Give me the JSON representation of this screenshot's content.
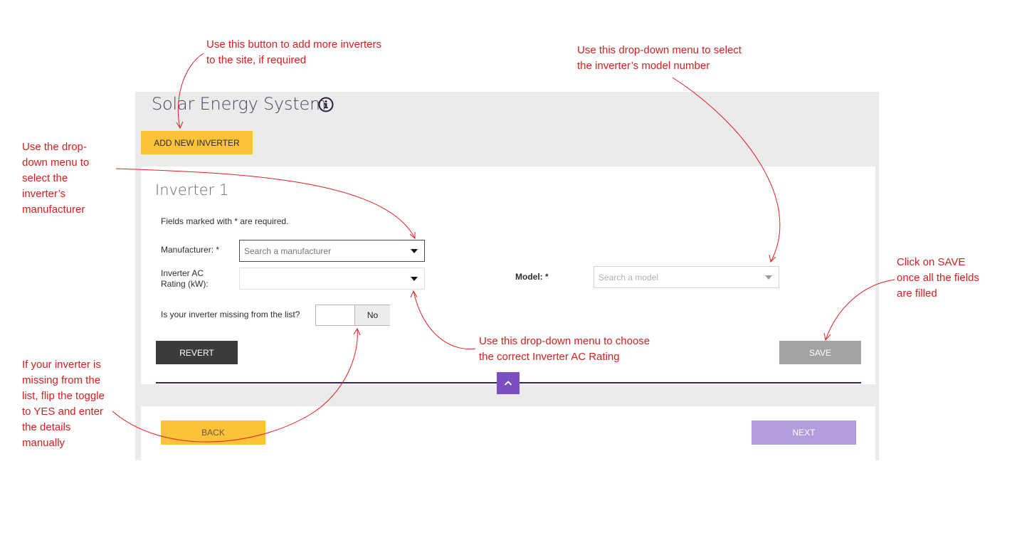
{
  "app": {
    "title": "Solar Energy System",
    "add_button": "ADD NEW INVERTER"
  },
  "inverter": {
    "heading": "Inverter 1",
    "required_note": "Fields marked with  *  are required.",
    "manufacturer_label": "Manufacturer: *",
    "manufacturer_placeholder": "Search a manufacturer",
    "rating_label_1": "Inverter AC",
    "rating_label_2": "Rating (kW):",
    "rating_value": "",
    "model_label": "Model: *",
    "model_placeholder": "Search a model",
    "missing_label": "Is your inverter missing from the list?",
    "missing_value": "No",
    "revert_button": "REVERT",
    "save_button": "SAVE"
  },
  "footer": {
    "back_button": "BACK",
    "next_button": "NEXT"
  },
  "annotations": {
    "add_inverter": [
      "Use this button to add more inverters",
      "to the site, if required"
    ],
    "model": [
      "Use this drop-down menu to select",
      "the inverter’s model number"
    ],
    "manufacturer": [
      "Use the drop-",
      "down menu to",
      "select the",
      "inverter’s",
      "manufacturer"
    ],
    "save": [
      "Click on SAVE",
      "once all the fields",
      "are filled"
    ],
    "rating": [
      "Use this drop-down menu to choose",
      "the correct Inverter AC Rating"
    ],
    "missing": [
      "If your inverter is",
      "missing from the",
      "list, flip the toggle",
      "to YES and enter",
      "the details",
      "manually"
    ]
  },
  "icons": {
    "info": "info-icon",
    "caret": "caret-down-icon",
    "collapse": "chevron-up-icon"
  },
  "colors": {
    "accent_yellow": "#fbc23a",
    "accent_purple": "#7b4fbf",
    "next_disabled": "#b39ddb",
    "annotation_red": "#d42020",
    "divider": "#3c2060"
  }
}
